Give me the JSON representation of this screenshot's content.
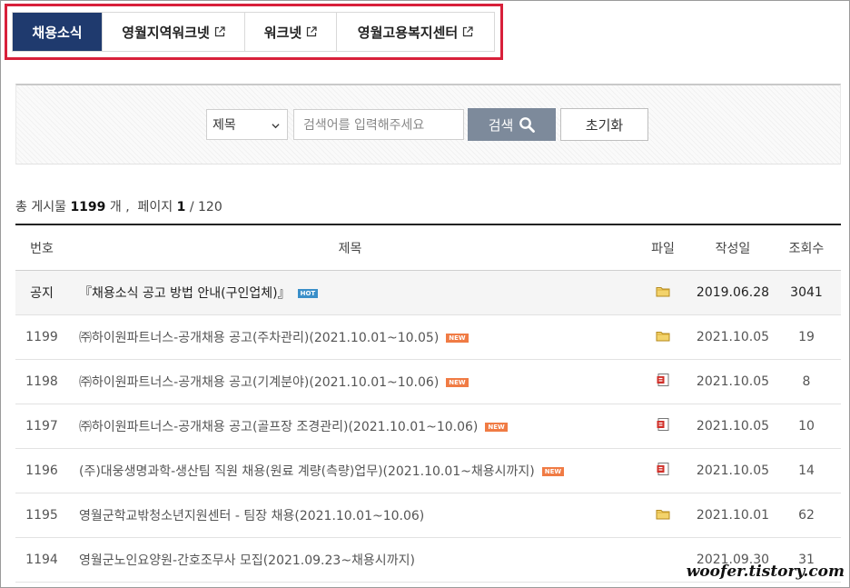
{
  "tabs": [
    {
      "label": "채용소식",
      "active": true,
      "external": false
    },
    {
      "label": "영월지역워크넷",
      "active": false,
      "external": true
    },
    {
      "label": "워크넷",
      "active": false,
      "external": true
    },
    {
      "label": "영월고용복지센터",
      "active": false,
      "external": true
    }
  ],
  "search": {
    "select_value": "제목",
    "placeholder": "검색어를 입력해주세요",
    "search_label": "검색",
    "reset_label": "초기화"
  },
  "count": {
    "prefix": "총 게시물",
    "total": "1199",
    "unit": "개 ,",
    "page_label": "페이지",
    "page": "1",
    "pages": "/ 120"
  },
  "columns": {
    "no": "번호",
    "title": "제목",
    "file": "파일",
    "date": "작성일",
    "views": "조회수"
  },
  "rows": [
    {
      "no": "공지",
      "title": "『채용소식 공고 방법 안내(구인업체)』",
      "badge": "HOT",
      "file": "folder-icon",
      "date": "2019.06.28",
      "views": "3041"
    },
    {
      "no": "1199",
      "title": "㈜하이원파트너스-공개채용 공고(주차관리)(2021.10.01~10.05)",
      "badge": "NEW",
      "file": "folder-icon",
      "date": "2021.10.05",
      "views": "19"
    },
    {
      "no": "1198",
      "title": "㈜하이원파트너스-공개채용 공고(기계분야)(2021.10.01~10.06)",
      "badge": "NEW",
      "file": "document-icon",
      "date": "2021.10.05",
      "views": "8"
    },
    {
      "no": "1197",
      "title": "㈜하이원파트너스-공개채용 공고(골프장 조경관리)(2021.10.01~10.06)",
      "badge": "NEW",
      "file": "document-icon",
      "date": "2021.10.05",
      "views": "10"
    },
    {
      "no": "1196",
      "title": "(주)대웅생명과학-생산팀 직원 채용(원료 계량(측량)업무)(2021.10.01~채용시까지)",
      "badge": "NEW",
      "file": "document-icon",
      "date": "2021.10.05",
      "views": "14"
    },
    {
      "no": "1195",
      "title": "영월군학교밖청소년지원센터 - 팀장 채용(2021.10.01~10.06)",
      "badge": "",
      "file": "folder-icon",
      "date": "2021.10.01",
      "views": "62"
    },
    {
      "no": "1194",
      "title": "영월군노인요양원-간호조무사 모집(2021.09.23~채용시까지)",
      "badge": "",
      "file": "",
      "date": "2021.09.30",
      "views": "31"
    }
  ],
  "watermark": "woofer.tistory.com",
  "colors": {
    "tab_active": "#1f3a6e",
    "highlight": "#d8203a",
    "search_button": "#7d8a9b",
    "hot": "#3a8fc9",
    "new": "#f07b44"
  }
}
